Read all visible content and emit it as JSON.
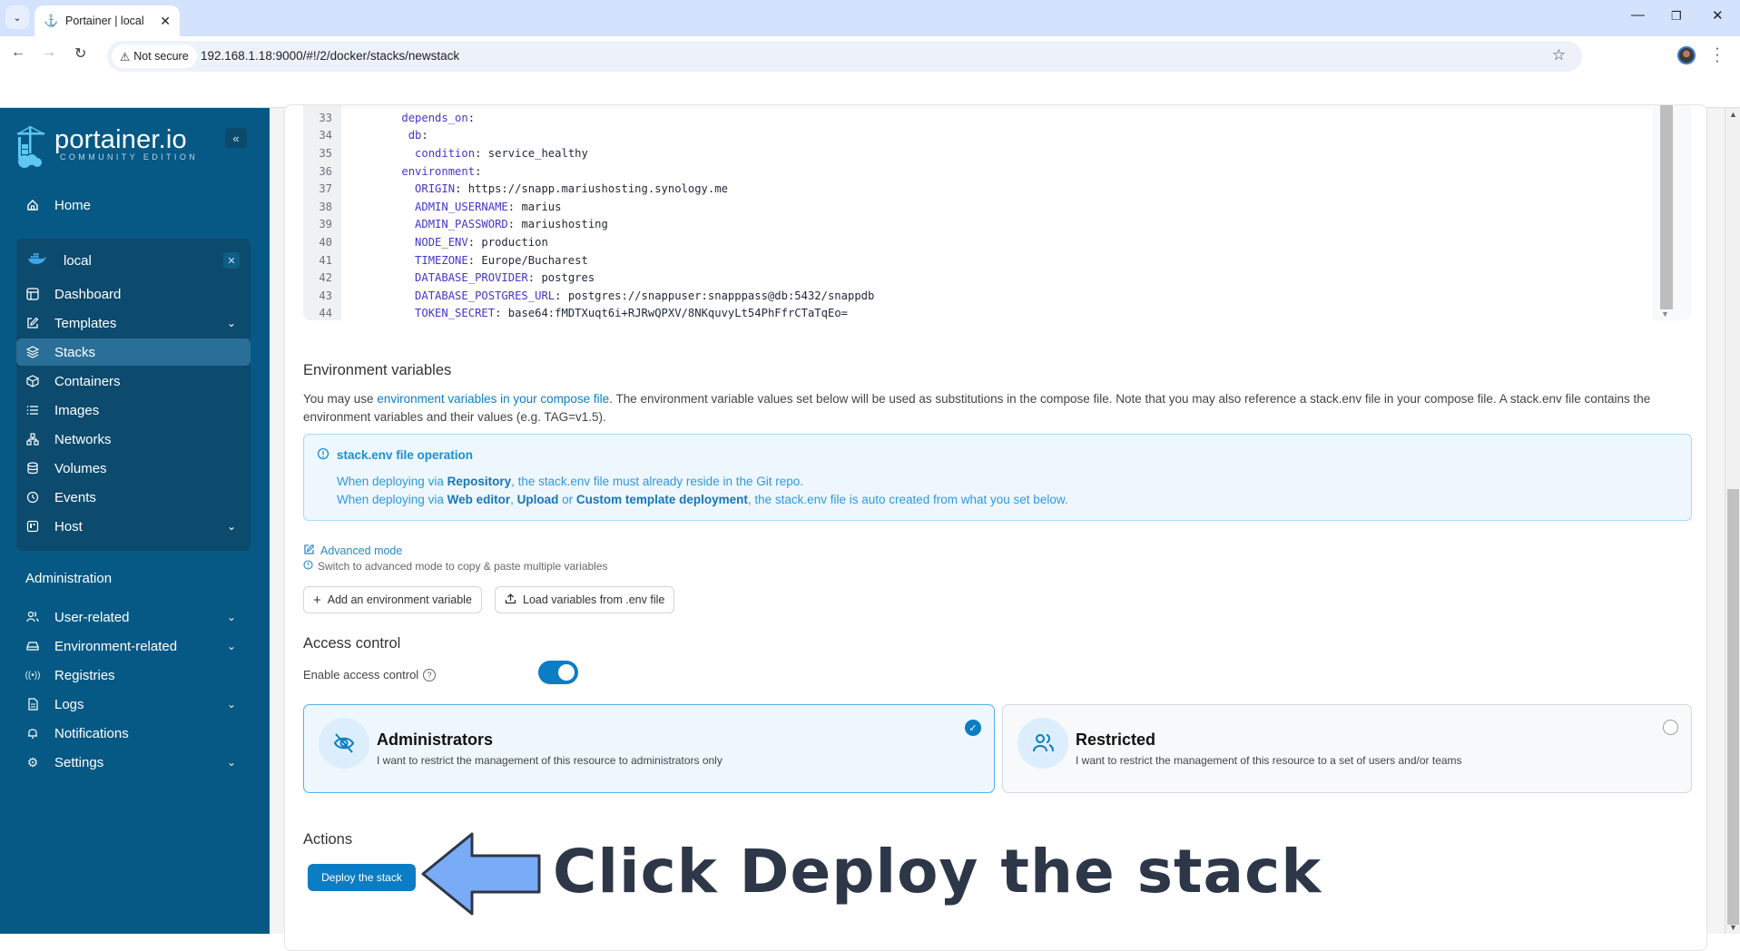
{
  "browser": {
    "tab_title": "Portainer | local",
    "not_secure_label": "Not secure",
    "url": "192.168.1.18:9000/#!/2/docker/stacks/newstack"
  },
  "sidebar": {
    "brand": "portainer.io",
    "edition": "COMMUNITY EDITION",
    "home": "Home",
    "environment": {
      "name": "local",
      "items": [
        {
          "label": "Dashboard",
          "icon": "dashboard-icon",
          "expandable": false
        },
        {
          "label": "Templates",
          "icon": "edit-icon",
          "expandable": true
        },
        {
          "label": "Stacks",
          "icon": "layers-icon",
          "expandable": false,
          "active": true
        },
        {
          "label": "Containers",
          "icon": "box-icon",
          "expandable": false
        },
        {
          "label": "Images",
          "icon": "list-icon",
          "expandable": false
        },
        {
          "label": "Networks",
          "icon": "network-icon",
          "expandable": false
        },
        {
          "label": "Volumes",
          "icon": "database-icon",
          "expandable": false
        },
        {
          "label": "Events",
          "icon": "clock-icon",
          "expandable": false
        },
        {
          "label": "Host",
          "icon": "host-icon",
          "expandable": true
        }
      ]
    },
    "admin_section": "Administration",
    "admin_items": [
      {
        "label": "User-related",
        "icon": "users-icon",
        "expandable": true
      },
      {
        "label": "Environment-related",
        "icon": "server-icon",
        "expandable": true
      },
      {
        "label": "Registries",
        "icon": "radio-icon",
        "expandable": false
      },
      {
        "label": "Logs",
        "icon": "file-text-icon",
        "expandable": true
      },
      {
        "label": "Notifications",
        "icon": "bell-icon",
        "expandable": false
      },
      {
        "label": "Settings",
        "icon": "gear-icon",
        "expandable": true
      }
    ]
  },
  "editor": {
    "lines": [
      {
        "n": "33",
        "indent": "    ",
        "key": "depends_on",
        "sep": ":",
        "val": ""
      },
      {
        "n": "34",
        "indent": "     ",
        "key": "db",
        "sep": ":",
        "val": ""
      },
      {
        "n": "35",
        "indent": "      ",
        "key": "condition",
        "sep": ": ",
        "val": "service_healthy"
      },
      {
        "n": "36",
        "indent": "    ",
        "key": "environment",
        "sep": ":",
        "val": ""
      },
      {
        "n": "37",
        "indent": "      ",
        "key": "ORIGIN",
        "sep": ": ",
        "val": "https://snapp.mariushosting.synology.me"
      },
      {
        "n": "38",
        "indent": "      ",
        "key": "ADMIN_USERNAME",
        "sep": ": ",
        "val": "marius"
      },
      {
        "n": "39",
        "indent": "      ",
        "key": "ADMIN_PASSWORD",
        "sep": ": ",
        "val": "mariushosting"
      },
      {
        "n": "40",
        "indent": "      ",
        "key": "NODE_ENV",
        "sep": ": ",
        "val": "production"
      },
      {
        "n": "41",
        "indent": "      ",
        "key": "TIMEZONE",
        "sep": ": ",
        "val": "Europe/Bucharest"
      },
      {
        "n": "42",
        "indent": "      ",
        "key": "DATABASE_PROVIDER",
        "sep": ": ",
        "val": "postgres"
      },
      {
        "n": "43",
        "indent": "      ",
        "key": "DATABASE_POSTGRES_URL",
        "sep": ": ",
        "val": "postgres://snappuser:snapppass@db:5432/snappdb"
      },
      {
        "n": "44",
        "indent": "      ",
        "key": "TOKEN_SECRET",
        "sep": ": ",
        "val": "base64:fMDTXuqt6i+RJRwQPXV/8NKquvyLt54PhFfrCTaTqEo="
      }
    ]
  },
  "env_vars": {
    "heading": "Environment variables",
    "para_pre": "You may use ",
    "para_link": "environment variables in your compose file",
    "para_post": ". The environment variable values set below will be used as substitutions in the compose file. Note that you may also reference a stack.env file in your compose file. A stack.env file contains the environment variables and their values (e.g. TAG=v1.5).",
    "alert_title": "stack.env file operation",
    "alert_l1_a": "When deploying via ",
    "alert_l1_b": "Repository",
    "alert_l1_c": ", the stack.env file must already reside in the Git repo.",
    "alert_l2_a": "When deploying via ",
    "alert_l2_b": "Web editor",
    "alert_l2_c": ", ",
    "alert_l2_d": "Upload",
    "alert_l2_e": " or ",
    "alert_l2_f": "Custom template deployment",
    "alert_l2_g": ", the stack.env file is auto created from what you set below.",
    "advanced_mode": "Advanced mode",
    "advanced_hint": "Switch to advanced mode to copy & paste multiple variables",
    "add_button": "Add an environment variable",
    "load_button": "Load variables from .env file"
  },
  "access": {
    "heading": "Access control",
    "enable_label": "Enable access control",
    "enabled": true,
    "options": [
      {
        "title": "Administrators",
        "desc": "I want to restrict the management of this resource to administrators only",
        "selected": true
      },
      {
        "title": "Restricted",
        "desc": "I want to restrict the management of this resource to a set of users and/or teams",
        "selected": false
      }
    ]
  },
  "actions": {
    "heading": "Actions",
    "deploy_button": "Deploy the stack"
  },
  "annotation": {
    "text": "Click Deploy the stack",
    "arrow_color": "#7aabf7"
  },
  "colors": {
    "sidebar_bg": "#075985",
    "env_box_bg": "#0c4a6e",
    "accent": "#0b7dc4"
  }
}
